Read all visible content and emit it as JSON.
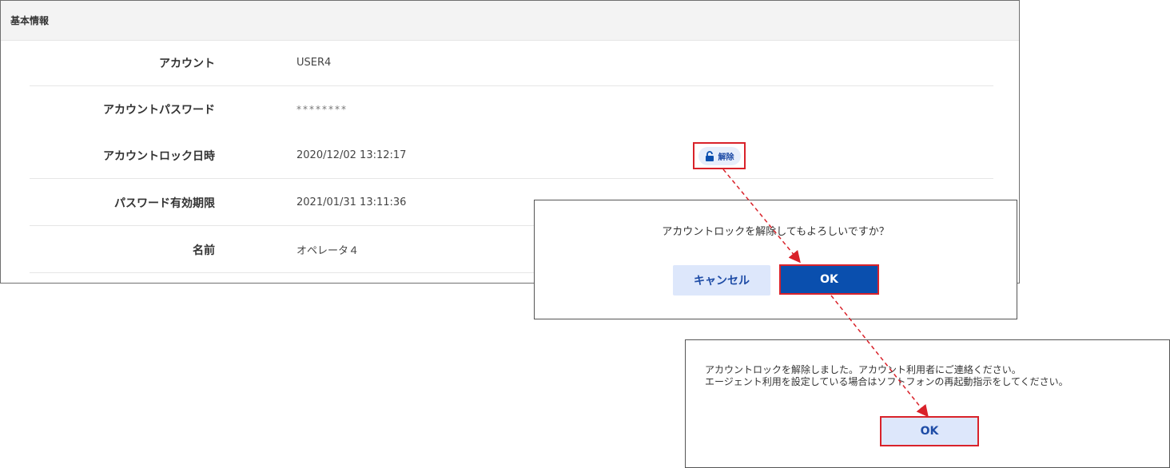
{
  "section": {
    "title": "基本情報"
  },
  "fields": [
    {
      "label": "アカウント",
      "value": "USER4"
    },
    {
      "label": "アカウントパスワード",
      "value": "********"
    },
    {
      "label": "アカウントロック日時",
      "value": "2020/12/02 13:12:17"
    },
    {
      "label": "パスワード有効期限",
      "value": "2021/01/31 13:11:36"
    },
    {
      "label": "名前",
      "value": "オペレータ４"
    }
  ],
  "unlock_button": {
    "label": "解除",
    "icon": "unlock-icon"
  },
  "confirm_dialog": {
    "message": "アカウントロックを解除してもよろしいですか？",
    "cancel_label": "キャンセル",
    "ok_label": "OK"
  },
  "result_dialog": {
    "line1": "アカウントロックを解除しました。アカウント利用者にご連絡ください。",
    "line2": "エージェント利用を設定している場合はソフトフォンの再起動指示をしてください。",
    "ok_label": "OK"
  },
  "colors": {
    "accent_blue": "#0a4fae",
    "light_blue": "#dde7fb",
    "highlight_red": "#d9222a"
  }
}
